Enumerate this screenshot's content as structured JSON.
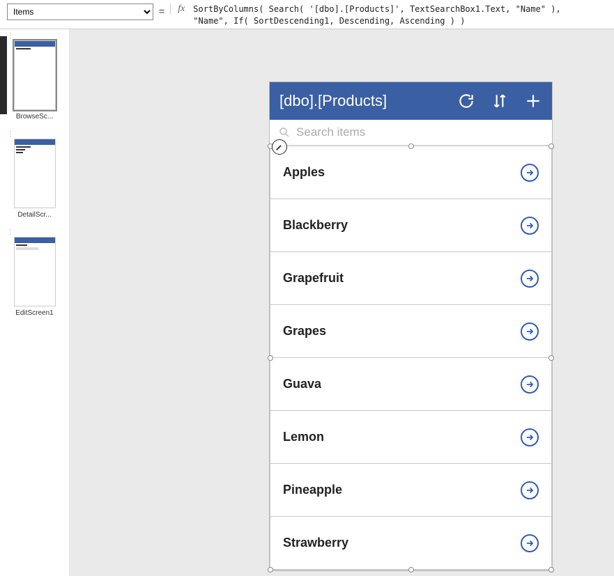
{
  "formula": {
    "property": "Items",
    "equals": "=",
    "fx": "fx",
    "text": "SortByColumns( Search( '[dbo].[Products]', TextSearchBox1.Text, \"Name\" ),\n\"Name\", If( SortDescending1, Descending, Ascending ) )"
  },
  "screens": [
    {
      "label": "BrowseSc...",
      "selected": true
    },
    {
      "label": "DetailScr...",
      "selected": false
    },
    {
      "label": "EditScreen1",
      "selected": false
    }
  ],
  "app": {
    "title": "[dbo].[Products]",
    "search_placeholder": "Search items",
    "items": [
      {
        "name": "Apples"
      },
      {
        "name": "Blackberry"
      },
      {
        "name": "Grapefruit"
      },
      {
        "name": "Grapes"
      },
      {
        "name": "Guava"
      },
      {
        "name": "Lemon"
      },
      {
        "name": "Pineapple"
      },
      {
        "name": "Strawberry"
      }
    ]
  }
}
